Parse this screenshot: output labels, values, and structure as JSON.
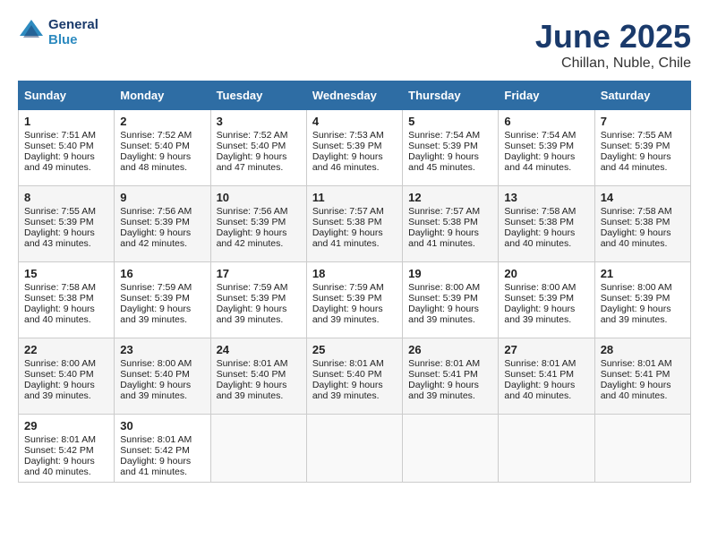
{
  "logo": {
    "text1": "General",
    "text2": "Blue"
  },
  "title": "June 2025",
  "location": "Chillan, Nuble, Chile",
  "headers": [
    "Sunday",
    "Monday",
    "Tuesday",
    "Wednesday",
    "Thursday",
    "Friday",
    "Saturday"
  ],
  "weeks": [
    [
      {
        "day": "1",
        "sunrise": "Sunrise: 7:51 AM",
        "sunset": "Sunset: 5:40 PM",
        "daylight": "Daylight: 9 hours and 49 minutes."
      },
      {
        "day": "2",
        "sunrise": "Sunrise: 7:52 AM",
        "sunset": "Sunset: 5:40 PM",
        "daylight": "Daylight: 9 hours and 48 minutes."
      },
      {
        "day": "3",
        "sunrise": "Sunrise: 7:52 AM",
        "sunset": "Sunset: 5:40 PM",
        "daylight": "Daylight: 9 hours and 47 minutes."
      },
      {
        "day": "4",
        "sunrise": "Sunrise: 7:53 AM",
        "sunset": "Sunset: 5:39 PM",
        "daylight": "Daylight: 9 hours and 46 minutes."
      },
      {
        "day": "5",
        "sunrise": "Sunrise: 7:54 AM",
        "sunset": "Sunset: 5:39 PM",
        "daylight": "Daylight: 9 hours and 45 minutes."
      },
      {
        "day": "6",
        "sunrise": "Sunrise: 7:54 AM",
        "sunset": "Sunset: 5:39 PM",
        "daylight": "Daylight: 9 hours and 44 minutes."
      },
      {
        "day": "7",
        "sunrise": "Sunrise: 7:55 AM",
        "sunset": "Sunset: 5:39 PM",
        "daylight": "Daylight: 9 hours and 44 minutes."
      }
    ],
    [
      {
        "day": "8",
        "sunrise": "Sunrise: 7:55 AM",
        "sunset": "Sunset: 5:39 PM",
        "daylight": "Daylight: 9 hours and 43 minutes."
      },
      {
        "day": "9",
        "sunrise": "Sunrise: 7:56 AM",
        "sunset": "Sunset: 5:39 PM",
        "daylight": "Daylight: 9 hours and 42 minutes."
      },
      {
        "day": "10",
        "sunrise": "Sunrise: 7:56 AM",
        "sunset": "Sunset: 5:39 PM",
        "daylight": "Daylight: 9 hours and 42 minutes."
      },
      {
        "day": "11",
        "sunrise": "Sunrise: 7:57 AM",
        "sunset": "Sunset: 5:38 PM",
        "daylight": "Daylight: 9 hours and 41 minutes."
      },
      {
        "day": "12",
        "sunrise": "Sunrise: 7:57 AM",
        "sunset": "Sunset: 5:38 PM",
        "daylight": "Daylight: 9 hours and 41 minutes."
      },
      {
        "day": "13",
        "sunrise": "Sunrise: 7:58 AM",
        "sunset": "Sunset: 5:38 PM",
        "daylight": "Daylight: 9 hours and 40 minutes."
      },
      {
        "day": "14",
        "sunrise": "Sunrise: 7:58 AM",
        "sunset": "Sunset: 5:38 PM",
        "daylight": "Daylight: 9 hours and 40 minutes."
      }
    ],
    [
      {
        "day": "15",
        "sunrise": "Sunrise: 7:58 AM",
        "sunset": "Sunset: 5:38 PM",
        "daylight": "Daylight: 9 hours and 40 minutes."
      },
      {
        "day": "16",
        "sunrise": "Sunrise: 7:59 AM",
        "sunset": "Sunset: 5:39 PM",
        "daylight": "Daylight: 9 hours and 39 minutes."
      },
      {
        "day": "17",
        "sunrise": "Sunrise: 7:59 AM",
        "sunset": "Sunset: 5:39 PM",
        "daylight": "Daylight: 9 hours and 39 minutes."
      },
      {
        "day": "18",
        "sunrise": "Sunrise: 7:59 AM",
        "sunset": "Sunset: 5:39 PM",
        "daylight": "Daylight: 9 hours and 39 minutes."
      },
      {
        "day": "19",
        "sunrise": "Sunrise: 8:00 AM",
        "sunset": "Sunset: 5:39 PM",
        "daylight": "Daylight: 9 hours and 39 minutes."
      },
      {
        "day": "20",
        "sunrise": "Sunrise: 8:00 AM",
        "sunset": "Sunset: 5:39 PM",
        "daylight": "Daylight: 9 hours and 39 minutes."
      },
      {
        "day": "21",
        "sunrise": "Sunrise: 8:00 AM",
        "sunset": "Sunset: 5:39 PM",
        "daylight": "Daylight: 9 hours and 39 minutes."
      }
    ],
    [
      {
        "day": "22",
        "sunrise": "Sunrise: 8:00 AM",
        "sunset": "Sunset: 5:40 PM",
        "daylight": "Daylight: 9 hours and 39 minutes."
      },
      {
        "day": "23",
        "sunrise": "Sunrise: 8:00 AM",
        "sunset": "Sunset: 5:40 PM",
        "daylight": "Daylight: 9 hours and 39 minutes."
      },
      {
        "day": "24",
        "sunrise": "Sunrise: 8:01 AM",
        "sunset": "Sunset: 5:40 PM",
        "daylight": "Daylight: 9 hours and 39 minutes."
      },
      {
        "day": "25",
        "sunrise": "Sunrise: 8:01 AM",
        "sunset": "Sunset: 5:40 PM",
        "daylight": "Daylight: 9 hours and 39 minutes."
      },
      {
        "day": "26",
        "sunrise": "Sunrise: 8:01 AM",
        "sunset": "Sunset: 5:41 PM",
        "daylight": "Daylight: 9 hours and 39 minutes."
      },
      {
        "day": "27",
        "sunrise": "Sunrise: 8:01 AM",
        "sunset": "Sunset: 5:41 PM",
        "daylight": "Daylight: 9 hours and 40 minutes."
      },
      {
        "day": "28",
        "sunrise": "Sunrise: 8:01 AM",
        "sunset": "Sunset: 5:41 PM",
        "daylight": "Daylight: 9 hours and 40 minutes."
      }
    ],
    [
      {
        "day": "29",
        "sunrise": "Sunrise: 8:01 AM",
        "sunset": "Sunset: 5:42 PM",
        "daylight": "Daylight: 9 hours and 40 minutes."
      },
      {
        "day": "30",
        "sunrise": "Sunrise: 8:01 AM",
        "sunset": "Sunset: 5:42 PM",
        "daylight": "Daylight: 9 hours and 41 minutes."
      },
      {
        "day": "",
        "sunrise": "",
        "sunset": "",
        "daylight": ""
      },
      {
        "day": "",
        "sunrise": "",
        "sunset": "",
        "daylight": ""
      },
      {
        "day": "",
        "sunrise": "",
        "sunset": "",
        "daylight": ""
      },
      {
        "day": "",
        "sunrise": "",
        "sunset": "",
        "daylight": ""
      },
      {
        "day": "",
        "sunrise": "",
        "sunset": "",
        "daylight": ""
      }
    ]
  ]
}
